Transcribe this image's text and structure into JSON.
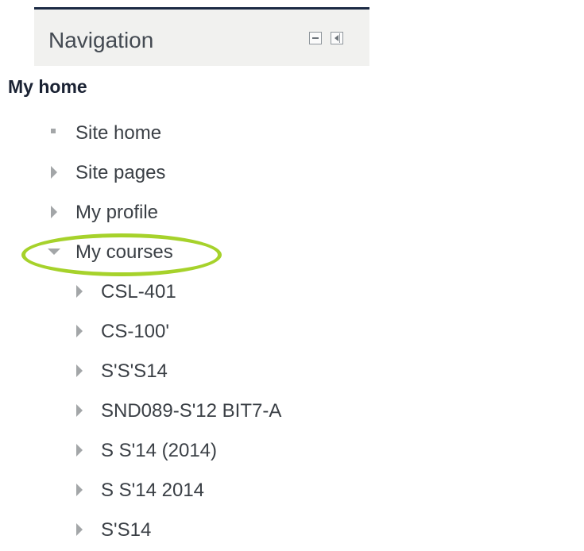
{
  "block": {
    "title": "Navigation",
    "controls": [
      {
        "name": "minimize",
        "icon": "minimize-icon"
      },
      {
        "name": "dock",
        "icon": "dock-icon"
      }
    ]
  },
  "nav": {
    "root_label": "My home",
    "items": [
      {
        "label": "Site home",
        "icon": "bullet-icon"
      },
      {
        "label": "Site pages",
        "icon": "chevron-right-icon"
      },
      {
        "label": "My profile",
        "icon": "chevron-right-icon"
      },
      {
        "label": "My courses",
        "icon": "chevron-down-icon",
        "expanded": true,
        "highlighted": true
      }
    ],
    "courses": [
      {
        "label": "CSL-401"
      },
      {
        "label": "CS-100'"
      },
      {
        "label": "S'S'S14"
      },
      {
        "label": "SND089-S'12 BIT7-A"
      },
      {
        "label": "S S'14 (2014)"
      },
      {
        "label": "S S'14 2014"
      },
      {
        "label": "S'S14"
      }
    ]
  },
  "colors": {
    "header_bar": "#1b2a44",
    "header_bg": "#f1f1ef",
    "highlight": "#a6d22b",
    "text": "#3a3f45"
  }
}
